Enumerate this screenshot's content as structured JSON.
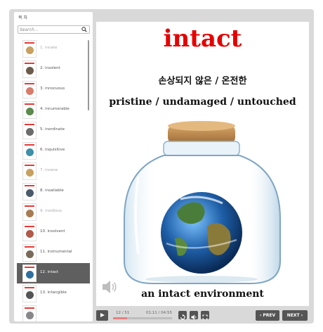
{
  "sidebar": {
    "title": "목 차",
    "search_placeholder": "Search...",
    "items": [
      {
        "label": "1. innate",
        "dim": true,
        "color": "#c8a060"
      },
      {
        "label": "2. insolent",
        "dim": false,
        "color": "#6b5b4b"
      },
      {
        "label": "3. innocuous",
        "dim": false,
        "color": "#d77b6a"
      },
      {
        "label": "4. innumerable",
        "dim": false,
        "color": "#5d8a4d"
      },
      {
        "label": "5. inordinate",
        "dim": false,
        "color": "#6b6b6b"
      },
      {
        "label": "6. inquisitive",
        "dim": false,
        "color": "#3f8fa8"
      },
      {
        "label": "7. insane",
        "dim": true,
        "color": "#c8a060"
      },
      {
        "label": "8. insatiable",
        "dim": false,
        "color": "#4a5a6a"
      },
      {
        "label": "9. insidious",
        "dim": true,
        "color": "#a67c52"
      },
      {
        "label": "10. insolvent",
        "dim": false,
        "color": "#b05a4a"
      },
      {
        "label": "11. instrumental",
        "dim": false,
        "color": "#7a6a5a"
      },
      {
        "label": "12. intact",
        "dim": false,
        "selected": true,
        "color": "#2f6fa0"
      },
      {
        "label": "13. intangible",
        "dim": false,
        "color": "#555555"
      },
      {
        "label": "",
        "dim": false,
        "color": "#888888"
      }
    ]
  },
  "slide": {
    "word": "intact",
    "korean": "손상되지 않은 / 온전한",
    "synonyms": "pristine / undamaged / untouched",
    "example": "an intact environment"
  },
  "toolbar": {
    "slide_counter": "12 / 51",
    "time": "01:11 / 04:55",
    "progress": 0.24,
    "prev_label": "‹ PREV",
    "next_label": "NEXT ›"
  },
  "icons": {
    "search": "search-icon",
    "play": "play-icon",
    "speaker": "speaker-icon",
    "replay": "replay-icon",
    "volume": "volume-icon",
    "fullscreen": "fullscreen-icon"
  }
}
